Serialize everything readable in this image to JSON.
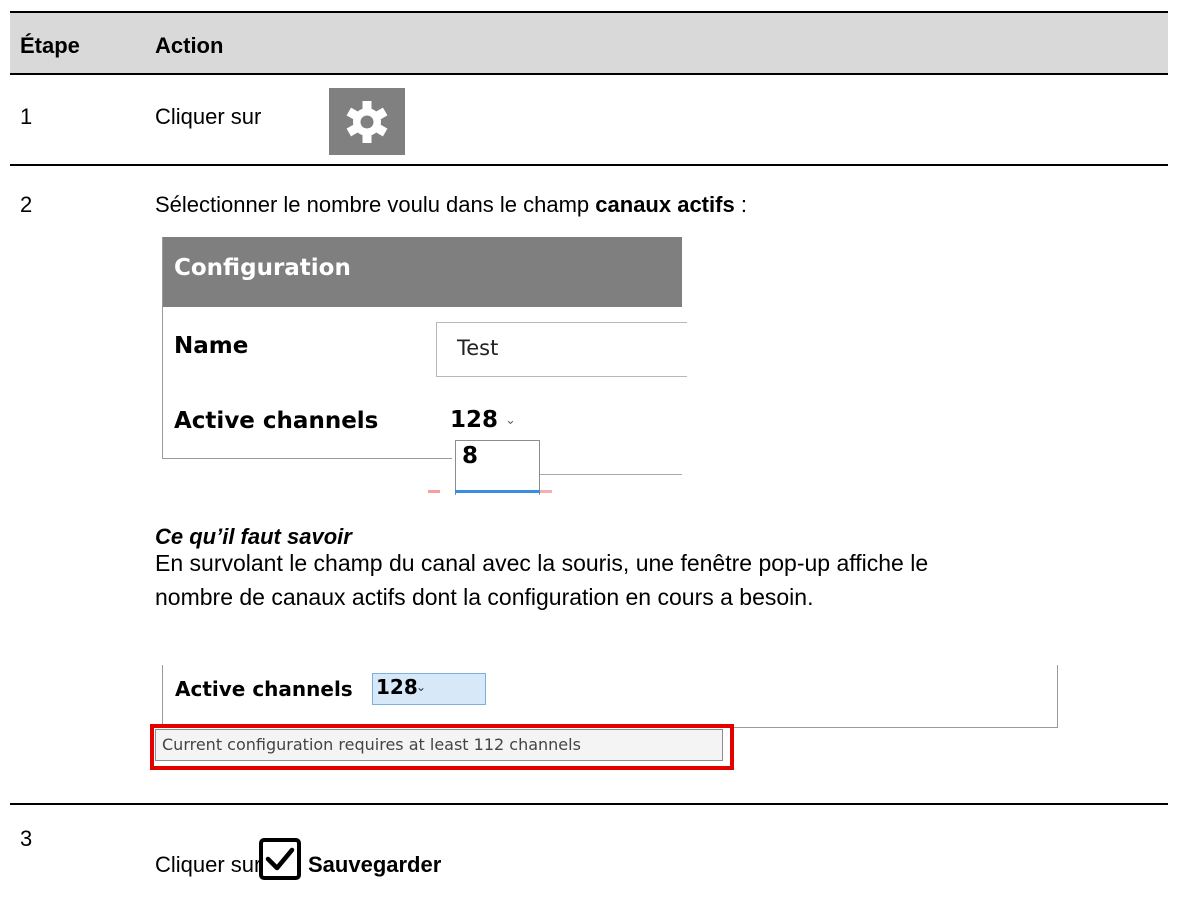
{
  "table": {
    "headers": [
      "Étape",
      "Action"
    ],
    "rows": [
      {
        "step": "1",
        "action_text": "Cliquer sur",
        "icon": "gear-icon"
      },
      {
        "step": "2",
        "action_text_prefix": "Sélectionner le nombre voulu dans le champ",
        "action_text_bold": "canaux actifs",
        "action_text_suffix": ":",
        "screenshot": {
          "title": "Configuration",
          "name_label": "Name",
          "name_value": "Test",
          "active_channels_label": "Active channels",
          "active_channels_value": "128",
          "dropdown_option": "8"
        },
        "note_title": "Ce qu’il faut savoir",
        "note_line1": "En survolant le champ du canal avec la souris, une fenêtre pop-up affiche le",
        "note_line2": "nombre de canaux actifs dont la configuration en cours a besoin.",
        "screenshot2": {
          "active_channels_label": "Active channels",
          "active_channels_value": "128",
          "tooltip": "Current configuration requires at least 112 channels"
        }
      },
      {
        "step": "3",
        "action_text": "Cliquer sur",
        "action_bold": "Sauvegarder",
        "icon": "checkbox-checked-icon"
      }
    ]
  },
  "colors": {
    "header_bg": "#d9d9d9",
    "gear_bg": "#808080",
    "config_header_bg": "#7f7f7f",
    "highlight_red": "#e50000",
    "select_highlight": "#d7e9f8"
  }
}
